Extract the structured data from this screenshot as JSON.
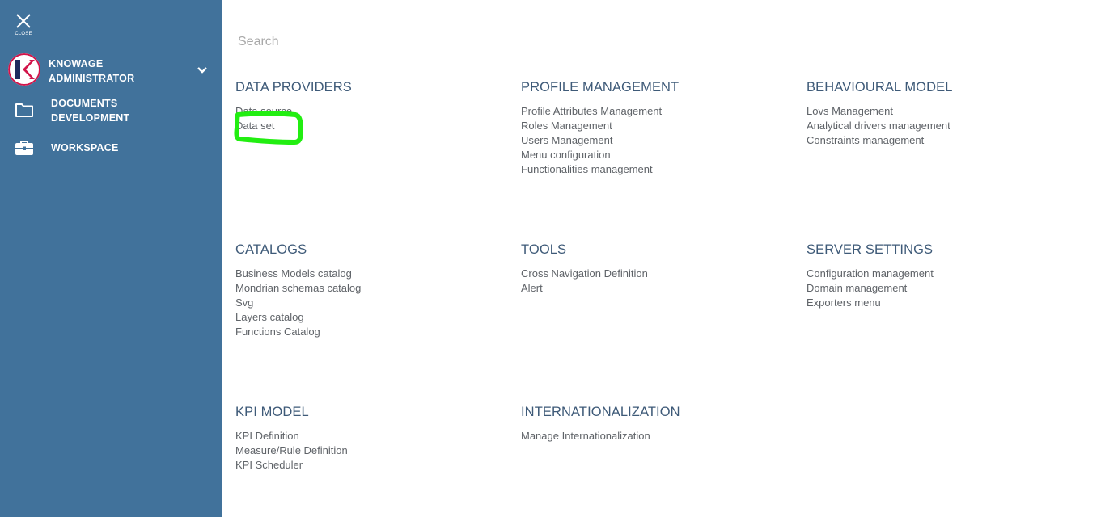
{
  "sidebar": {
    "close_label": "CLOSE",
    "user": {
      "name": "KNOWAGE ADMINISTRATOR",
      "avatar_letter": "K"
    },
    "items": [
      {
        "label": "DOCUMENTS DEVELOPMENT",
        "icon": "folder-icon"
      },
      {
        "label": "WORKSPACE",
        "icon": "briefcase-icon"
      }
    ]
  },
  "search": {
    "placeholder": "Search",
    "value": ""
  },
  "sections": [
    {
      "title": "DATA PROVIDERS",
      "items": [
        "Data source",
        "Data set"
      ]
    },
    {
      "title": "PROFILE MANAGEMENT",
      "items": [
        "Profile Attributes Management",
        "Roles Management",
        "Users Management",
        "Menu configuration",
        "Functionalities management"
      ]
    },
    {
      "title": "BEHAVIOURAL MODEL",
      "items": [
        "Lovs Management",
        "Analytical drivers management",
        "Constraints management"
      ]
    },
    {
      "title": "CATALOGS",
      "items": [
        "Business Models catalog",
        "Mondrian schemas catalog",
        "Svg",
        "Layers catalog",
        "Functions Catalog"
      ]
    },
    {
      "title": "TOOLS",
      "items": [
        "Cross Navigation Definition",
        "Alert"
      ]
    },
    {
      "title": "SERVER SETTINGS",
      "items": [
        "Configuration management",
        "Domain management",
        "Exporters menu"
      ]
    },
    {
      "title": "KPI MODEL",
      "items": [
        "KPI Definition",
        "Measure/Rule Definition",
        "KPI Scheduler"
      ]
    },
    {
      "title": "INTERNATIONALIZATION",
      "items": [
        "Manage Internationalization"
      ]
    }
  ],
  "colors": {
    "sidebar_bg": "#41729b",
    "section_title": "#3e5a78",
    "item_text": "#5f6368",
    "highlight": "#22ee11",
    "logo_red": "#d2144a",
    "logo_navy": "#1f2a5c"
  }
}
